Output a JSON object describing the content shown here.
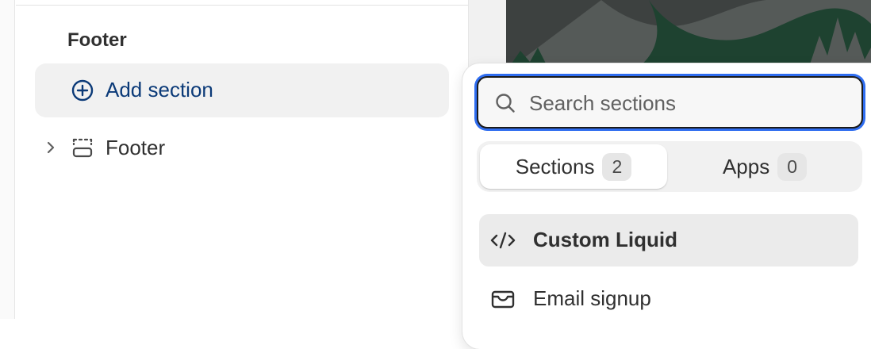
{
  "editor": {
    "group_title": "Footer",
    "add_section_label": "Add section",
    "footer_item_label": "Footer"
  },
  "picker": {
    "search_placeholder": "Search sections",
    "search_value": "",
    "tabs": [
      {
        "label": "Sections",
        "count": "2",
        "active": true
      },
      {
        "label": "Apps",
        "count": "0",
        "active": false
      }
    ],
    "items": [
      {
        "label": "Custom Liquid",
        "icon": "code-icon",
        "selected": true
      },
      {
        "label": "Email signup",
        "icon": "envelope-icon",
        "selected": false
      }
    ]
  },
  "colors": {
    "link_blue": "#0b3a78",
    "focus_ring": "#2f6df0",
    "preview_green": "#1e4230",
    "preview_gray": "#555a58"
  }
}
